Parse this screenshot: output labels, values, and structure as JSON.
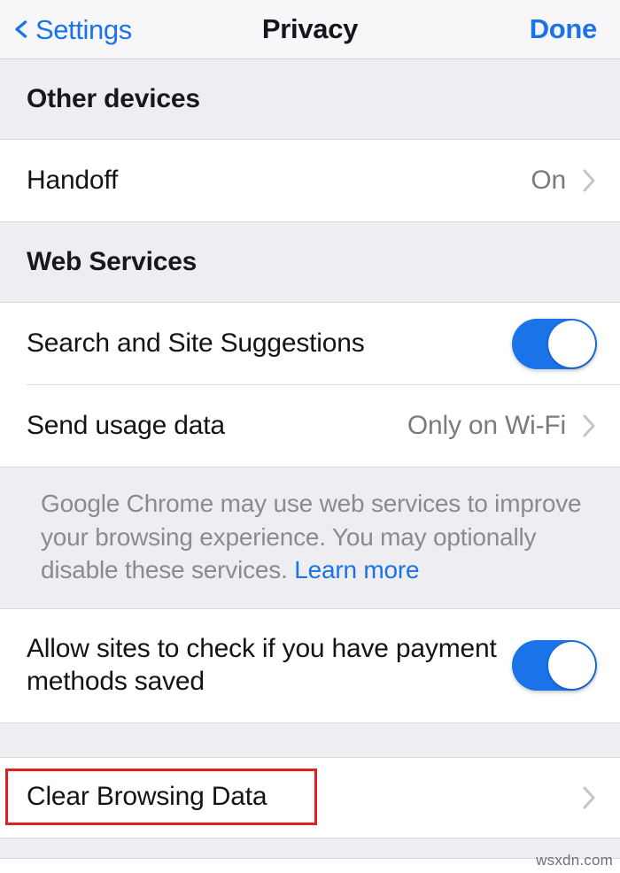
{
  "navbar": {
    "back_label": "Settings",
    "back_icon": "chevron-left-icon",
    "title": "Privacy",
    "done_label": "Done"
  },
  "sections": {
    "other_devices": {
      "header": "Other devices",
      "rows": [
        {
          "title": "Handoff",
          "value": "On",
          "accessory": "chevron-right-icon"
        }
      ]
    },
    "web_services": {
      "header": "Web Services",
      "rows": [
        {
          "title": "Search and Site Suggestions",
          "accessory": "toggle-switch",
          "toggle_on": true
        },
        {
          "title": "Send usage data",
          "value": "Only on Wi-Fi",
          "accessory": "chevron-right-icon"
        }
      ],
      "footer_text": "Google Chrome may use web services to improve your browsing experience. You may optionally disable these services. ",
      "footer_link": "Learn more"
    },
    "payments": {
      "rows": [
        {
          "title": "Allow sites to check if you have payment methods saved",
          "accessory": "toggle-switch",
          "toggle_on": true
        }
      ]
    },
    "clear_data": {
      "rows": [
        {
          "title": "Clear Browsing Data",
          "accessory": "chevron-right-icon"
        }
      ]
    }
  },
  "watermark": "wsxdn.com",
  "colors": {
    "accent_blue": "#1a73e8",
    "toggle_on": "#1a73e8",
    "highlight_red": "#e02020",
    "group_background": "#eeeef2",
    "row_background": "#ffffff",
    "secondary_text": "#7a7a80"
  }
}
